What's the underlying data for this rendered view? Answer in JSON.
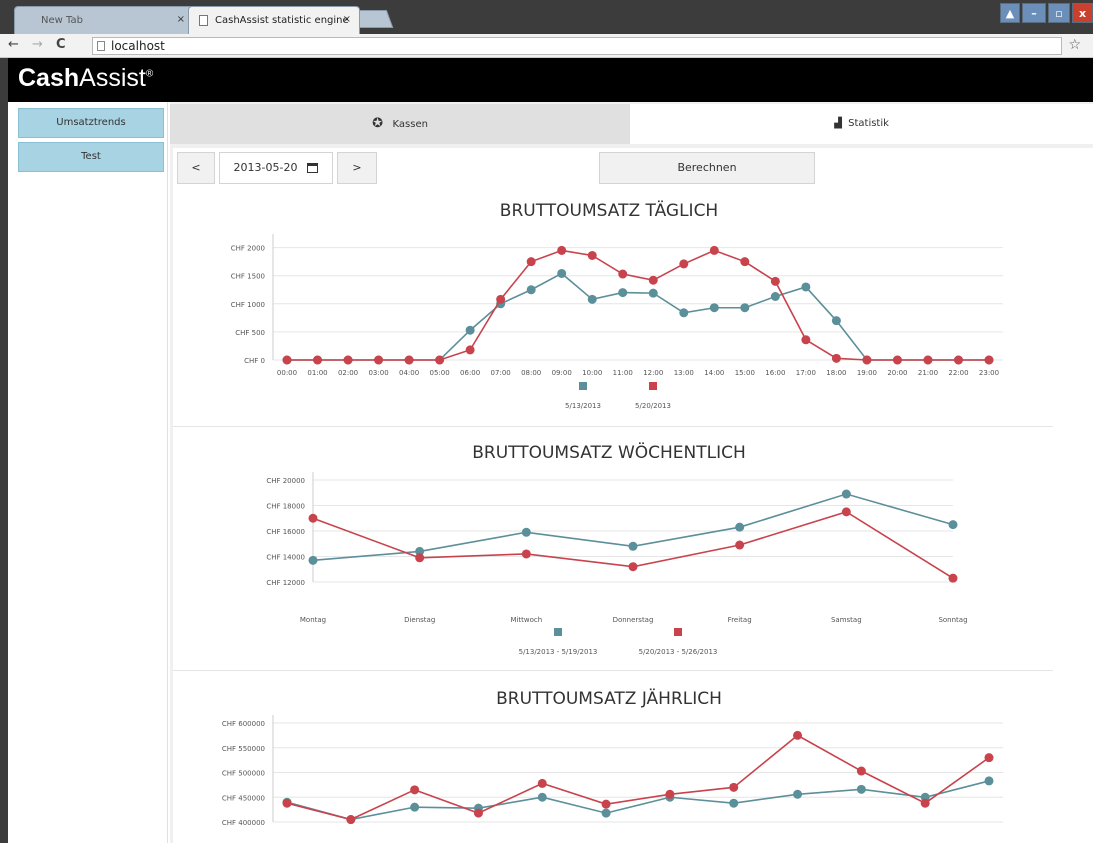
{
  "browser": {
    "tabs": [
      {
        "label": "New Tab",
        "close": "×"
      },
      {
        "label": "CashAssist statistic engine",
        "close": "×"
      }
    ],
    "url": "localhost",
    "nav": {
      "back": "←",
      "forward": "→",
      "reload": "C"
    },
    "window_buttons": {
      "user": "▲",
      "minimize": "–",
      "restore": "▫",
      "close": "x"
    }
  },
  "app": {
    "logo_bold": "Cash",
    "logo_regular": "Assist",
    "logo_mark": "®"
  },
  "sidebar": {
    "items": [
      {
        "label": "Umsatztrends"
      },
      {
        "label": "Test"
      }
    ]
  },
  "top_tabs": {
    "kassen": "Kassen",
    "statistik": "Statistik"
  },
  "controls": {
    "prev": "<",
    "date": "2013-05-20",
    "next": ">",
    "calculate": "Berechnen"
  },
  "colors": {
    "series_a": "#5b8f99",
    "series_b": "#c8434c"
  },
  "chart_data": [
    {
      "type": "line",
      "title": "BRUTTOUMSATZ TÄGLICH",
      "x": [
        "00:00",
        "01:00",
        "02:00",
        "03:00",
        "04:00",
        "05:00",
        "06:00",
        "07:00",
        "08:00",
        "09:00",
        "10:00",
        "11:00",
        "12:00",
        "13:00",
        "14:00",
        "15:00",
        "16:00",
        "17:00",
        "18:00",
        "19:00",
        "20:00",
        "21:00",
        "22:00",
        "23:00"
      ],
      "yticks": [
        "CHF 0",
        "CHF 500",
        "CHF 1000",
        "CHF 1500",
        "CHF 2000"
      ],
      "ylim": [
        0,
        2100
      ],
      "series": [
        {
          "name": "5/13/2013",
          "values": [
            0,
            0,
            0,
            0,
            0,
            0,
            530,
            1000,
            1250,
            1540,
            1080,
            1200,
            1190,
            840,
            930,
            930,
            1130,
            1300,
            700,
            0,
            0,
            0,
            0,
            0
          ]
        },
        {
          "name": "5/20/2013",
          "values": [
            0,
            0,
            0,
            0,
            0,
            0,
            180,
            1080,
            1750,
            1950,
            1860,
            1530,
            1420,
            1710,
            1950,
            1750,
            1400,
            360,
            30,
            0,
            0,
            0,
            0,
            0
          ]
        }
      ]
    },
    {
      "type": "line",
      "title": "BRUTTOUMSATZ WÖCHENTLICH",
      "x": [
        "Montag",
        "Dienstag",
        "Mittwoch",
        "Donnerstag",
        "Freitag",
        "Samstag",
        "Sonntag"
      ],
      "yticks": [
        "CHF 12000",
        "CHF 14000",
        "CHF 16000",
        "CHF 18000",
        "CHF 20000"
      ],
      "ylim": [
        12000,
        20000
      ],
      "series": [
        {
          "name": "5/13/2013 - 5/19/2013",
          "values": [
            13700,
            14400,
            15900,
            14800,
            16300,
            18900,
            16500
          ]
        },
        {
          "name": "5/20/2013 - 5/26/2013",
          "values": [
            17000,
            13900,
            14200,
            13200,
            14900,
            17500,
            12300
          ]
        }
      ]
    },
    {
      "type": "line",
      "title": "BRUTTOUMSATZ JÄHRLICH",
      "yticks": [
        "CHF 400000",
        "CHF 450000",
        "CHF 500000",
        "CHF 550000",
        "CHF 600000"
      ],
      "ylim": [
        400000,
        600000
      ],
      "series": [
        {
          "values": [
            440000,
            405000,
            430000,
            428000,
            450000,
            418000,
            450000,
            438000,
            456000,
            466000,
            450000,
            483000
          ]
        },
        {
          "values": [
            438000,
            405000,
            465000,
            418000,
            478000,
            436000,
            456000,
            470000,
            575000,
            503000,
            438000,
            530000
          ]
        }
      ]
    }
  ]
}
